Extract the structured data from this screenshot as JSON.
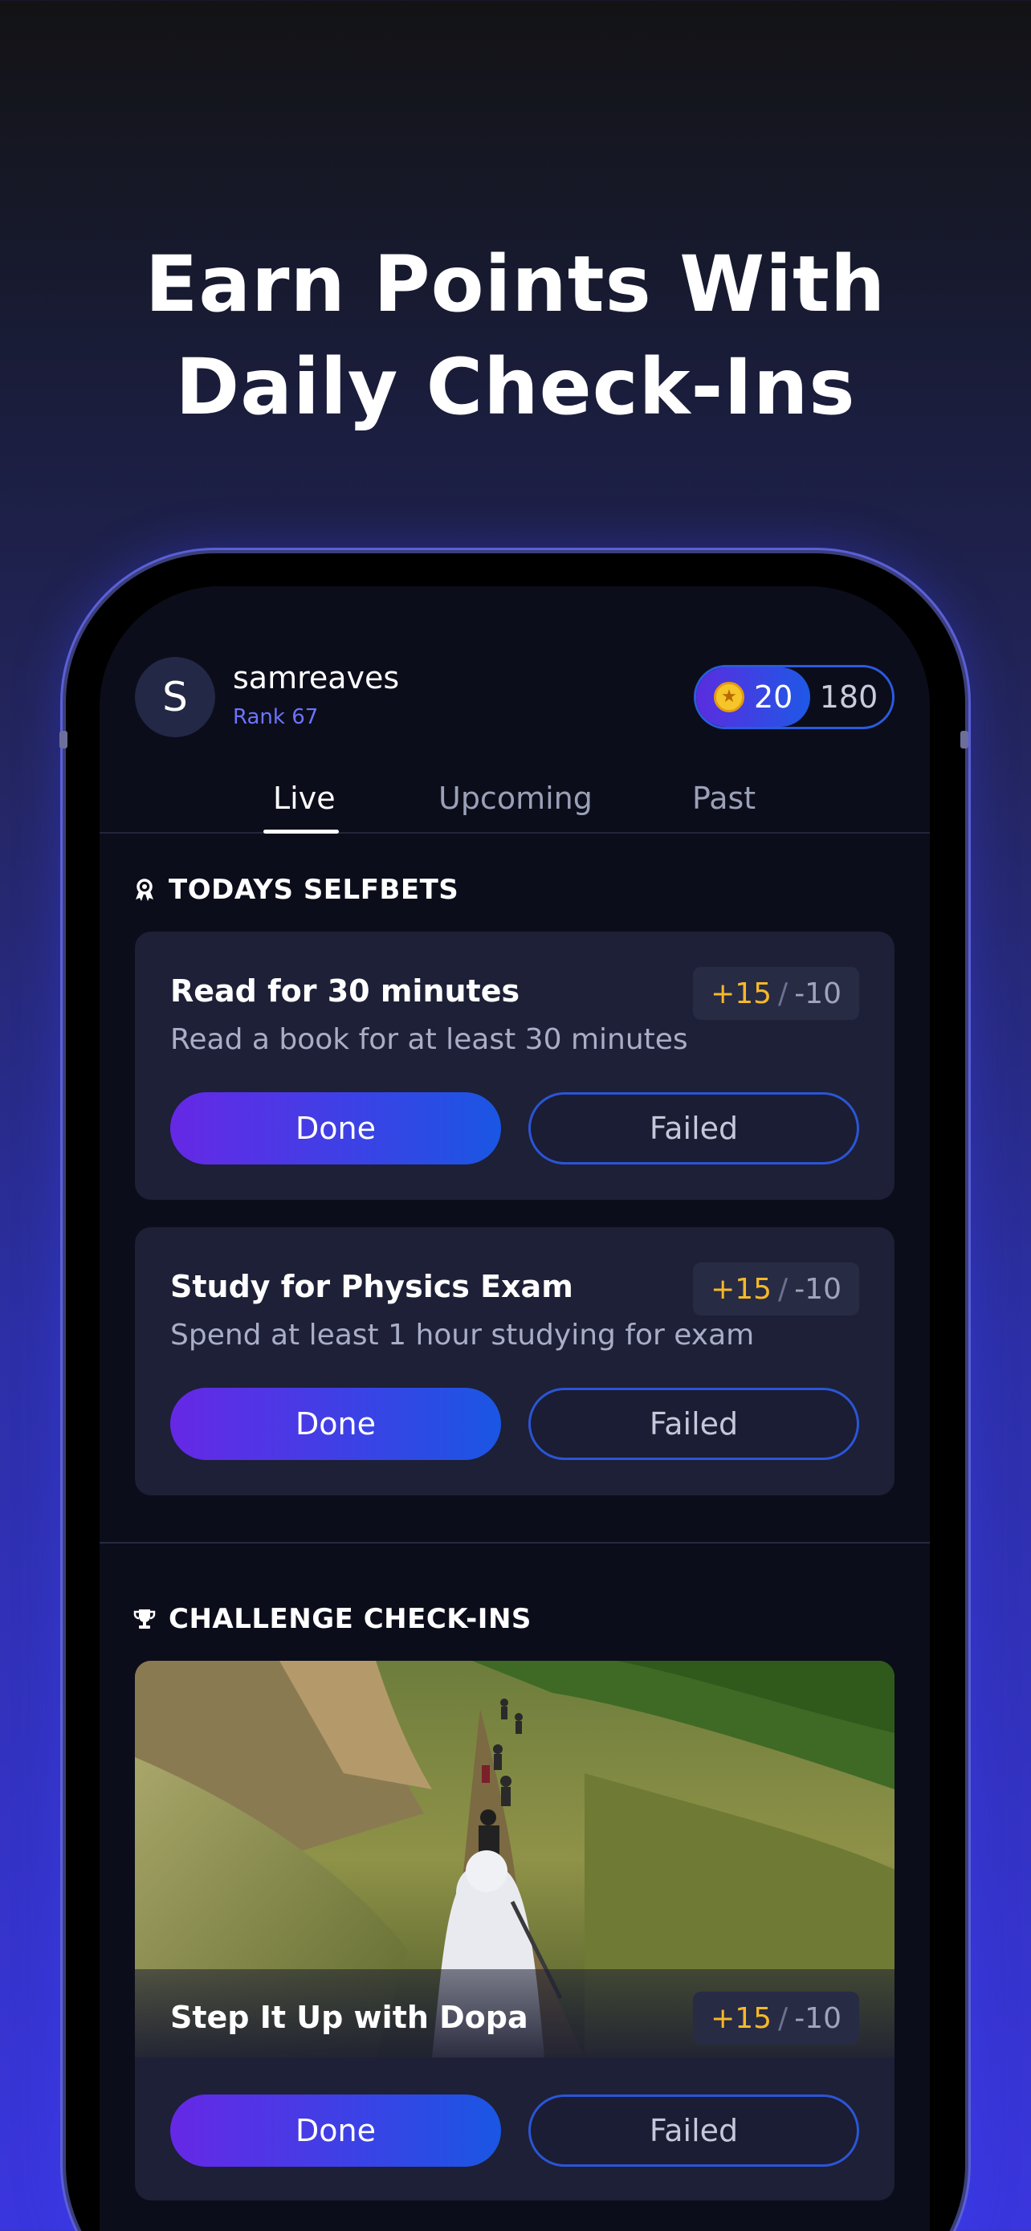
{
  "headline": {
    "line1": "Earn Points With",
    "line2": "Daily Check-Ins"
  },
  "profile": {
    "avatar_initial": "S",
    "username": "samreaves",
    "rank": "Rank 67"
  },
  "points": {
    "earned": "20",
    "total": "180"
  },
  "tabs": [
    {
      "label": "Live",
      "active": true
    },
    {
      "label": "Upcoming",
      "active": false
    },
    {
      "label": "Past",
      "active": false
    }
  ],
  "selfbets": {
    "title": "TODAYS SELFBETS",
    "items": [
      {
        "title": "Read for 30 minutes",
        "description": "Read a book for at least 30 minutes",
        "plus": "+15",
        "minus": "-10",
        "done_label": "Done",
        "failed_label": "Failed"
      },
      {
        "title": "Study for Physics Exam",
        "description": "Spend at least 1 hour studying for exam",
        "plus": "+15",
        "minus": "-10",
        "done_label": "Done",
        "failed_label": "Failed"
      }
    ]
  },
  "challenges": {
    "title": "CHALLENGE CHECK-INS",
    "items": [
      {
        "title": "Step It Up with Dopa",
        "plus": "+15",
        "minus": "-10",
        "done_label": "Done",
        "failed_label": "Failed"
      }
    ]
  },
  "score_separator": "/",
  "colors": {
    "accent": "#6b74ff",
    "gold": "#f5b82a",
    "primary_gradient_start": "#6628e6",
    "primary_gradient_end": "#1a56e4"
  }
}
